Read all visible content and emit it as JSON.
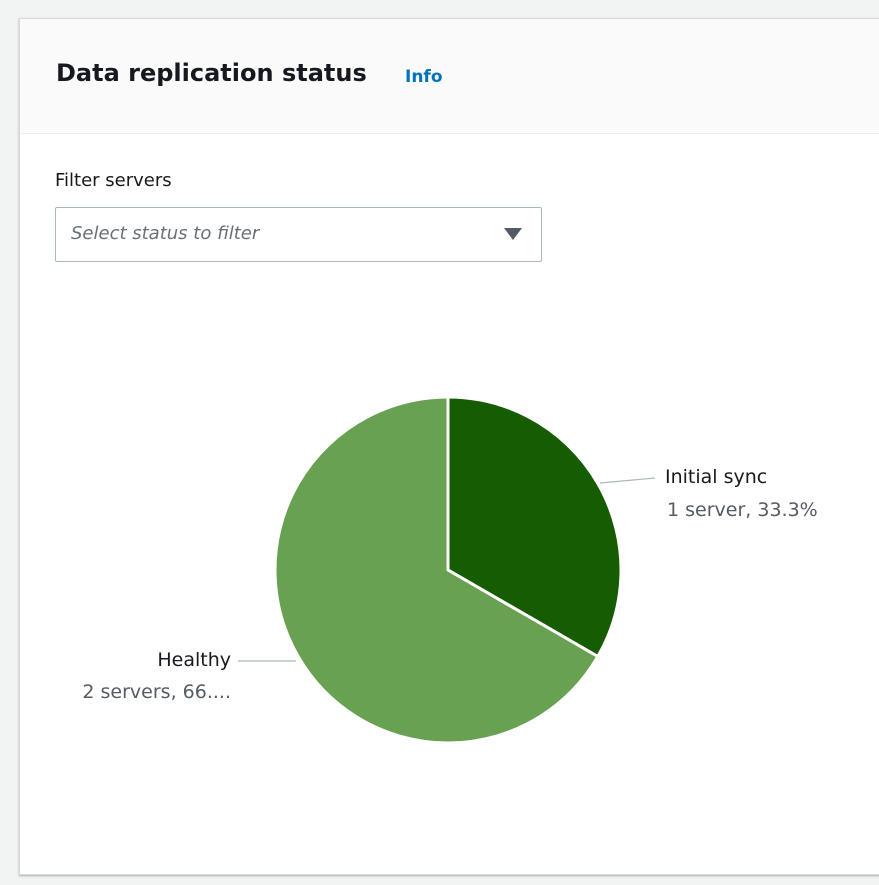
{
  "card": {
    "title": "Data replication status",
    "info_link": "Info"
  },
  "filter": {
    "label": "Filter servers",
    "placeholder": "Select status to filter"
  },
  "colors": {
    "initial_sync": "#165c02",
    "healthy": "#68a152",
    "info_link": "#0073bb"
  },
  "chart_data": {
    "type": "pie",
    "series": [
      {
        "name": "Initial sync",
        "value": 1,
        "label": "1 server, 33.3%",
        "color": "#165c02"
      },
      {
        "name": "Healthy",
        "value": 2,
        "label": "2 servers, 66....",
        "color": "#68a152"
      }
    ]
  }
}
